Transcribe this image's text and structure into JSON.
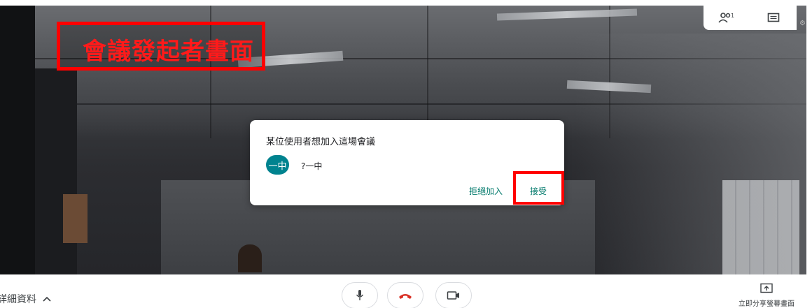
{
  "annotation": {
    "label": "會議發起者畫面",
    "color": "#ff0000"
  },
  "top_panel": {
    "participants_icon": "people-icon",
    "participants_count": "1",
    "chat_icon": "chat-icon"
  },
  "dialog": {
    "title": "某位使用者想加入這場會議",
    "user": {
      "avatar_text": "一中",
      "avatar_color": "#00838f",
      "name": "?一中"
    },
    "deny_label": "拒絕加入",
    "accept_label": "接受",
    "accent_color": "#00796b"
  },
  "bottom_bar": {
    "details_label": "詳細資料",
    "details_icon": "chevron-up-icon",
    "mic_icon": "microphone-icon",
    "hangup_icon": "hang-up-icon",
    "hangup_color": "#d93025",
    "camera_icon": "video-camera-icon",
    "share_icon": "present-screen-icon",
    "share_label": "立即分享螢幕畫面"
  }
}
